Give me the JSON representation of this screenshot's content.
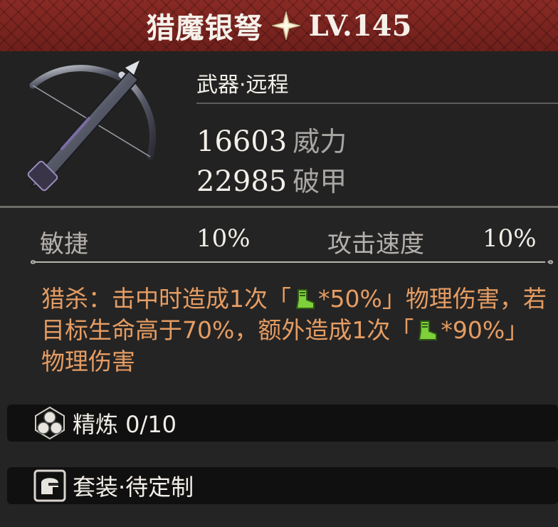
{
  "header": {
    "item_name": "猎魔银弩",
    "level": "LV.145",
    "star_icon": "four-point-star-icon"
  },
  "item": {
    "category": "武器·远程",
    "stats": [
      {
        "value": "16603",
        "label": "威力"
      },
      {
        "value": "22985",
        "label": "破甲"
      }
    ]
  },
  "attributes": [
    {
      "label": "敏捷",
      "value": "10%"
    },
    {
      "label": "攻击速度",
      "value": "10%"
    }
  ],
  "effect": {
    "part1": "猎杀：击中时造成1次「",
    "part2": "*50%」物理伤害，若目标生命高于70%，额外造成1次「",
    "part3": "*90%」物理伤害",
    "stat_icon": "green-boot-icon"
  },
  "refine": {
    "icon": "refine-orbs-icon",
    "text": "精炼 0/10"
  },
  "set": {
    "icon": "helmet-icon",
    "text": "套装·待定制"
  },
  "colors": {
    "header_red": "#7a241f",
    "effect_orange": "#e59d63",
    "icon_green": "#7fd13b"
  }
}
